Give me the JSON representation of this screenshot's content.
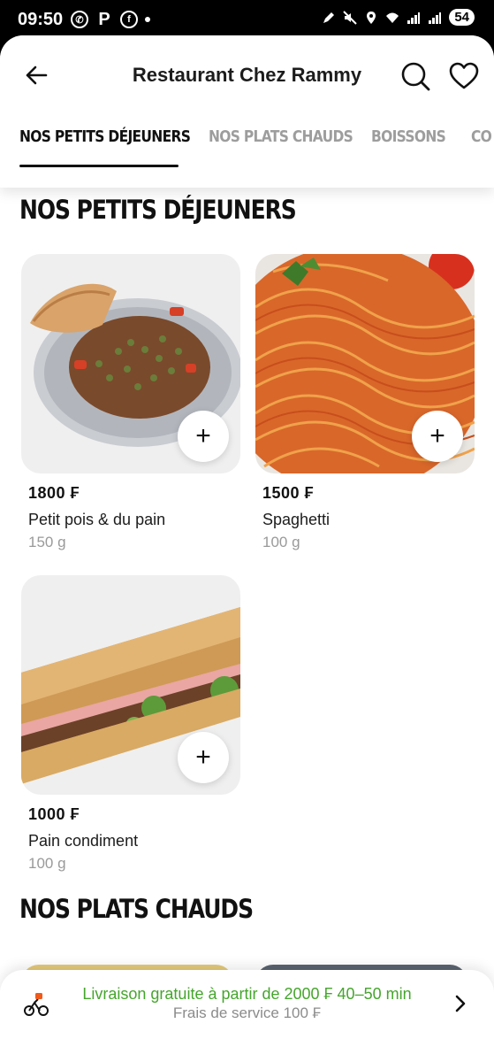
{
  "status_bar": {
    "time": "09:50",
    "battery": "54"
  },
  "header": {
    "title": "Restaurant Chez Rammy"
  },
  "tabs": [
    {
      "label": "NOS PETITS DÉJEUNERS"
    },
    {
      "label": "NOS PLATS CHAUDS"
    },
    {
      "label": "BOISSONS"
    },
    {
      "label": "CO"
    }
  ],
  "sections": [
    {
      "title": "NOS PETITS DÉJEUNERS"
    },
    {
      "title": "NOS PLATS CHAUDS"
    }
  ],
  "products": [
    {
      "price": "1800 ₣",
      "name": "Petit pois & du pain",
      "weight": "150 g",
      "add_label": "+"
    },
    {
      "price": "1500 ₣",
      "name": "Spaghetti",
      "weight": "100 g",
      "add_label": "+"
    },
    {
      "price": "1000 ₣",
      "name": "Pain condiment",
      "weight": "100 g",
      "add_label": "+"
    }
  ],
  "delivery": {
    "main": "Livraison gratuite à partir de 2000 ₣ 40–50 min",
    "sub": "Frais de service 100 ₣"
  },
  "colors": {
    "accent_green": "#45a52c",
    "text_primary": "#111111",
    "text_muted": "#9a9a9a"
  }
}
